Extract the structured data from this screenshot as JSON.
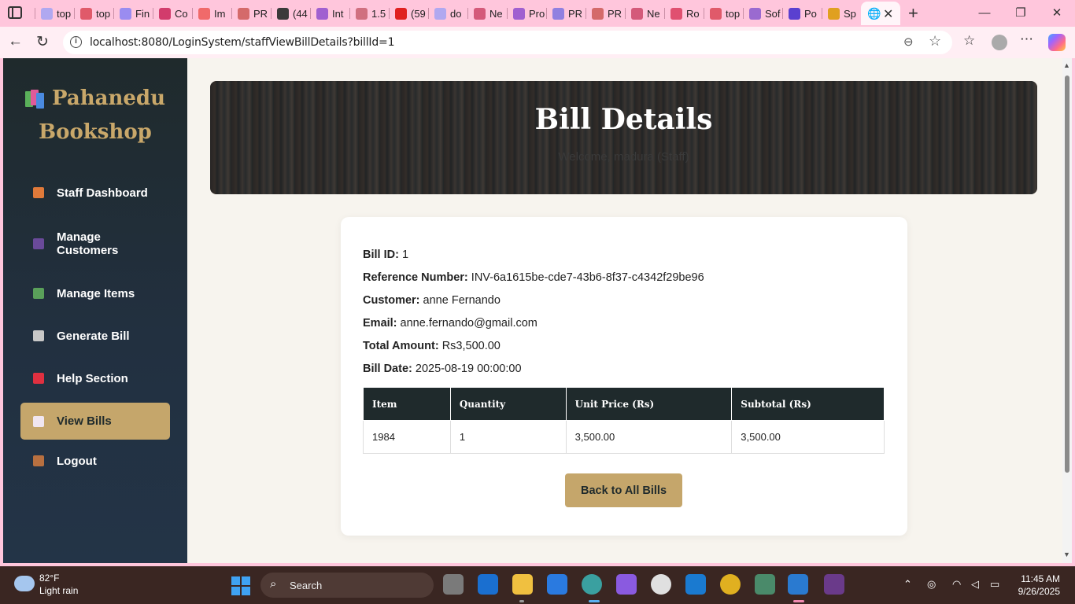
{
  "browser": {
    "tabs": [
      {
        "label": "top",
        "color": "#b0a8f0"
      },
      {
        "label": "top",
        "color": "#e05a6a"
      },
      {
        "label": "Fin",
        "color": "#9a8cf0"
      },
      {
        "label": "Co",
        "color": "#d23c6c"
      },
      {
        "label": "Im",
        "color": "#f06a6a"
      },
      {
        "label": "PR",
        "color": "#d46a6a"
      },
      {
        "label": "(44",
        "color": "#3a3a3a"
      },
      {
        "label": "Int",
        "color": "#a060d0"
      },
      {
        "label": "1.5",
        "color": "#d07080"
      },
      {
        "label": "(59",
        "color": "#e02020"
      },
      {
        "label": "do",
        "color": "#b0a8f0"
      },
      {
        "label": "Ne",
        "color": "#d45a7a"
      },
      {
        "label": "Pro",
        "color": "#a060d0"
      },
      {
        "label": "PR",
        "color": "#9080e0"
      },
      {
        "label": "PR",
        "color": "#d46a6a"
      },
      {
        "label": "Ne",
        "color": "#d45a7a"
      },
      {
        "label": "Ro",
        "color": "#e05070"
      },
      {
        "label": "top",
        "color": "#e05a6a"
      },
      {
        "label": "Sof",
        "color": "#9a6ad0"
      },
      {
        "label": "Po",
        "color": "#5a40d0"
      },
      {
        "label": "Sp",
        "color": "#e0a020"
      }
    ],
    "active_tab_close": "✕",
    "new_tab": "+",
    "url": "localhost:8080/LoginSystem/staffViewBillDetails?billId=1",
    "minimize": "—",
    "restore": "❐",
    "close": "✕"
  },
  "sidebar": {
    "brand_line1": "Pahanedu",
    "brand_line2": "Bookshop",
    "items": [
      {
        "label": "Staff Dashboard",
        "icon": "house-icon",
        "color": "#e07a3a"
      },
      {
        "label": "Manage Customers",
        "icon": "person-icon",
        "color": "#6a4a9a"
      },
      {
        "label": "Manage Items",
        "icon": "books-icon",
        "color": "#5aa05a"
      },
      {
        "label": "Generate Bill",
        "icon": "receipt-icon",
        "color": "#c8c8c8"
      },
      {
        "label": "Help Section",
        "icon": "question-icon",
        "color": "#e03040"
      },
      {
        "label": "View Bills",
        "icon": "notepad-icon",
        "color": "#f0e6f0"
      },
      {
        "label": "Logout",
        "icon": "door-icon",
        "color": "#b87040"
      }
    ]
  },
  "hero": {
    "title": "Bill Details",
    "subtitle": "Welcome, madura (Staff)"
  },
  "bill": {
    "id_label": "Bill ID:",
    "id_value": "1",
    "ref_label": "Reference Number:",
    "ref_value": "INV-6a1615be-cde7-43b6-8f37-c4342f29be96",
    "customer_label": "Customer:",
    "customer_value": "anne Fernando",
    "email_label": "Email:",
    "email_value": "anne.fernando@gmail.com",
    "total_label": "Total Amount:",
    "total_value": "Rs3,500.00",
    "date_label": "Bill Date:",
    "date_value": "2025-08-19 00:00:00"
  },
  "table": {
    "headers": [
      "Item",
      "Quantity",
      "Unit Price (Rs)",
      "Subtotal (Rs)"
    ],
    "rows": [
      [
        "1984",
        "1",
        "3,500.00",
        "3,500.00"
      ]
    ]
  },
  "back_button": "Back to All Bills",
  "taskbar": {
    "temperature": "82°F",
    "weather": "Light rain",
    "search": "Search",
    "time": "11:45 AM",
    "date": "9/26/2025"
  }
}
